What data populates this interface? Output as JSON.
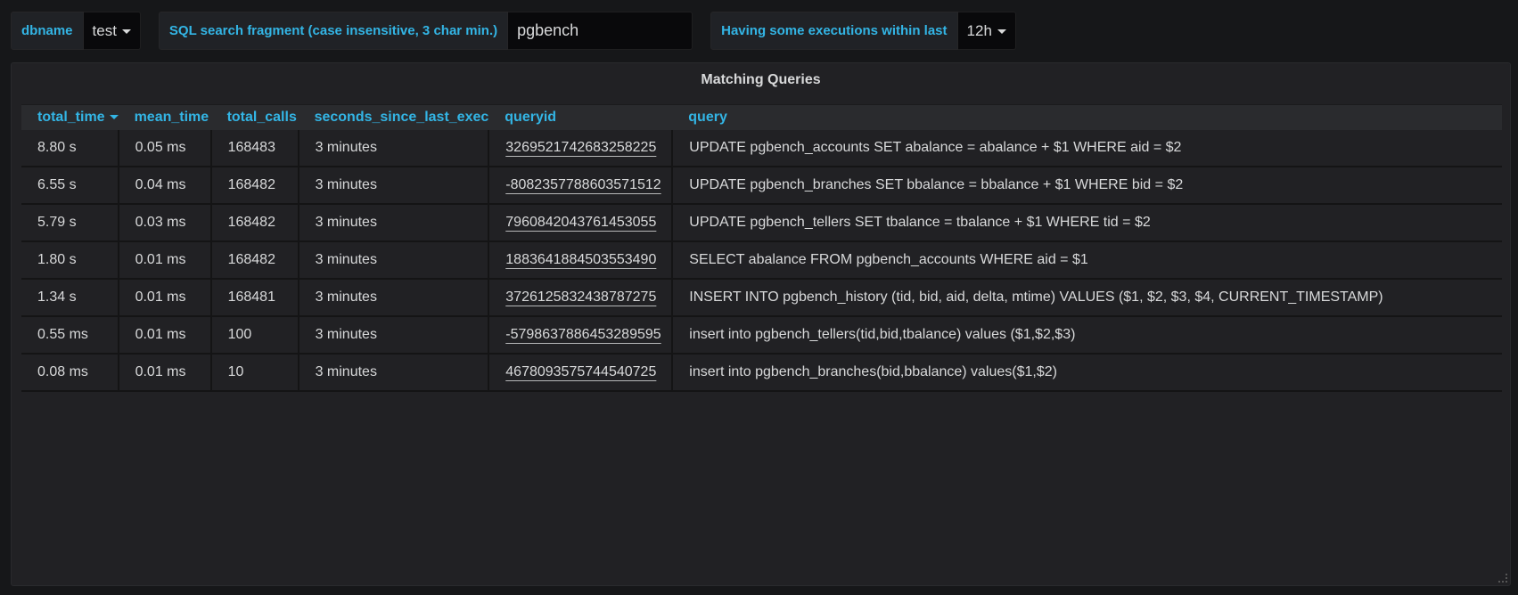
{
  "variables": {
    "dbname": {
      "label": "dbname",
      "value": "test"
    },
    "search": {
      "label": "SQL search fragment (case insensitive, 3 char min.)",
      "value": "pgbench"
    },
    "window": {
      "label": "Having some executions within last",
      "value": "12h"
    }
  },
  "panel": {
    "title": "Matching Queries",
    "columns": [
      "total_time",
      "mean_time",
      "total_calls",
      "seconds_since_last_exec",
      "queryid",
      "query"
    ],
    "sorted_column": "total_time",
    "sort_direction": "desc",
    "rows": [
      {
        "total_time": "8.80 s",
        "mean_time": "0.05 ms",
        "total_calls": "168483",
        "seconds_since_last_exec": "3 minutes",
        "queryid": "3269521742683258225",
        "query": "UPDATE pgbench_accounts SET abalance = abalance + $1 WHERE aid = $2"
      },
      {
        "total_time": "6.55 s",
        "mean_time": "0.04 ms",
        "total_calls": "168482",
        "seconds_since_last_exec": "3 minutes",
        "queryid": "-8082357788603571512",
        "query": "UPDATE pgbench_branches SET bbalance = bbalance + $1 WHERE bid = $2"
      },
      {
        "total_time": "5.79 s",
        "mean_time": "0.03 ms",
        "total_calls": "168482",
        "seconds_since_last_exec": "3 minutes",
        "queryid": "7960842043761453055",
        "query": "UPDATE pgbench_tellers SET tbalance = tbalance + $1 WHERE tid = $2"
      },
      {
        "total_time": "1.80 s",
        "mean_time": "0.01 ms",
        "total_calls": "168482",
        "seconds_since_last_exec": "3 minutes",
        "queryid": "1883641884503553490",
        "query": "SELECT abalance FROM pgbench_accounts WHERE aid = $1"
      },
      {
        "total_time": "1.34 s",
        "mean_time": "0.01 ms",
        "total_calls": "168481",
        "seconds_since_last_exec": "3 minutes",
        "queryid": "3726125832438787275",
        "query": "INSERT INTO pgbench_history (tid, bid, aid, delta, mtime) VALUES ($1, $2, $3, $4, CURRENT_TIMESTAMP)"
      },
      {
        "total_time": "0.55 ms",
        "mean_time": "0.01 ms",
        "total_calls": "100",
        "seconds_since_last_exec": "3 minutes",
        "queryid": "-5798637886453289595",
        "query": "insert into pgbench_tellers(tid,bid,tbalance) values ($1,$2,$3)"
      },
      {
        "total_time": "0.08 ms",
        "mean_time": "0.01 ms",
        "total_calls": "10",
        "seconds_since_last_exec": "3 minutes",
        "queryid": "4678093575744540725",
        "query": "insert into pgbench_branches(bid,bbalance) values($1,$2)"
      }
    ]
  },
  "colors": {
    "accent": "#33b5e5",
    "background": "#161719",
    "panel": "#212124",
    "text": "#d8d9da"
  }
}
